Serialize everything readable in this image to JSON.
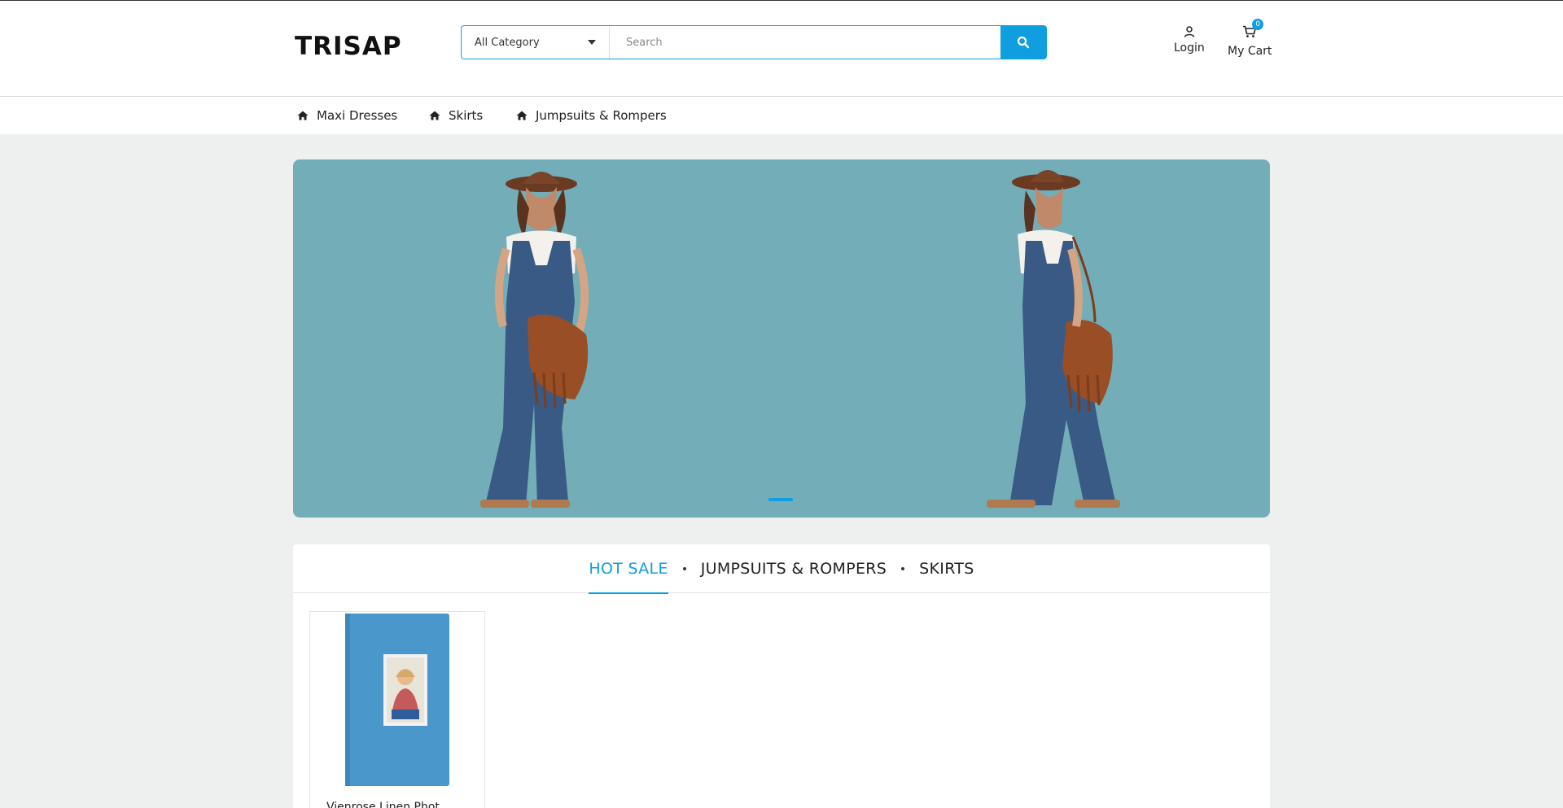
{
  "header": {
    "logo": "TRISAP",
    "category_select": "All Category",
    "search_placeholder": "Search",
    "login_label": "Login",
    "cart_label": "My Cart",
    "cart_count": "0"
  },
  "nav": {
    "items": [
      {
        "label": "Maxi Dresses",
        "icon": "home-icon"
      },
      {
        "label": "Skirts",
        "icon": "home-icon"
      },
      {
        "label": "Jumpsuits & Rompers",
        "icon": "home-icon"
      }
    ]
  },
  "banner": {
    "background": "#73adb8",
    "active_slide": 1
  },
  "product_tabs": {
    "tabs": [
      "HOT SALE",
      "JUMPSUITS & ROMPERS",
      "SKIRTS"
    ],
    "active": "HOT SALE"
  },
  "products": [
    {
      "title": "Vienrose Linen Phot"
    }
  ],
  "colors": {
    "accent": "#0f9ee0",
    "page_bg": "#eef0ef"
  }
}
